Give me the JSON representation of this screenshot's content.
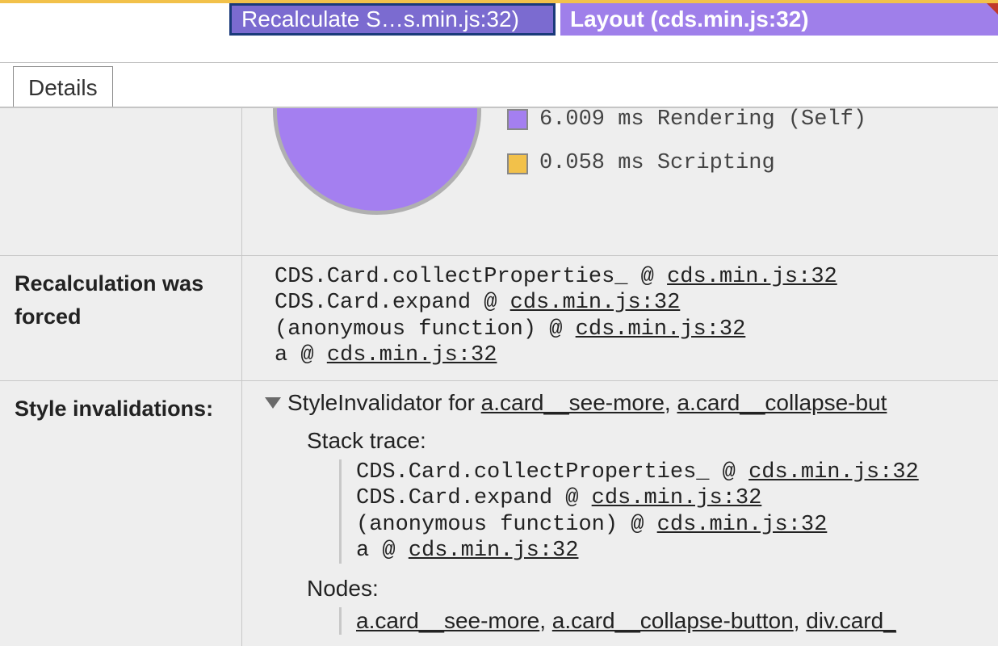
{
  "flame": {
    "selected_label": "Recalculate S…s.min.js:32)",
    "layout_label": "Layout (cds.min.js:32)"
  },
  "tab": {
    "details": "Details"
  },
  "chart_data": {
    "type": "pie",
    "series": [
      {
        "name": "Rendering (Self)",
        "value": 6.009,
        "unit": "ms",
        "color": "#a47ff0"
      },
      {
        "name": "Scripting",
        "value": 0.058,
        "unit": "ms",
        "color": "#f2c14a"
      }
    ]
  },
  "legend": {
    "rendering": "6.009 ms Rendering (Self)",
    "scripting": "0.058 ms Scripting"
  },
  "rows": {
    "recalc_label": "Recalculation was forced",
    "style_inval_label": "Style invalidations:"
  },
  "stack1": {
    "l0_fn": "CDS.Card.collectProperties_ @ ",
    "l0_link": "cds.min.js:32",
    "l1_fn": "CDS.Card.expand @ ",
    "l1_link": "cds.min.js:32",
    "l2_fn": "(anonymous function) @ ",
    "l2_link": "cds.min.js:32",
    "l3_fn": "a @ ",
    "l3_link": "cds.min.js:32"
  },
  "si": {
    "header_prefix": "StyleInvalidator for ",
    "sel1": "a.card__see-more",
    "sep": ", ",
    "sel2": "a.card__collapse-but",
    "stack_trace_label": "Stack trace:",
    "nodes_label": "Nodes:",
    "node1": "a.card__see-more",
    "node2": "a.card__collapse-button",
    "node3": "div.card_"
  }
}
